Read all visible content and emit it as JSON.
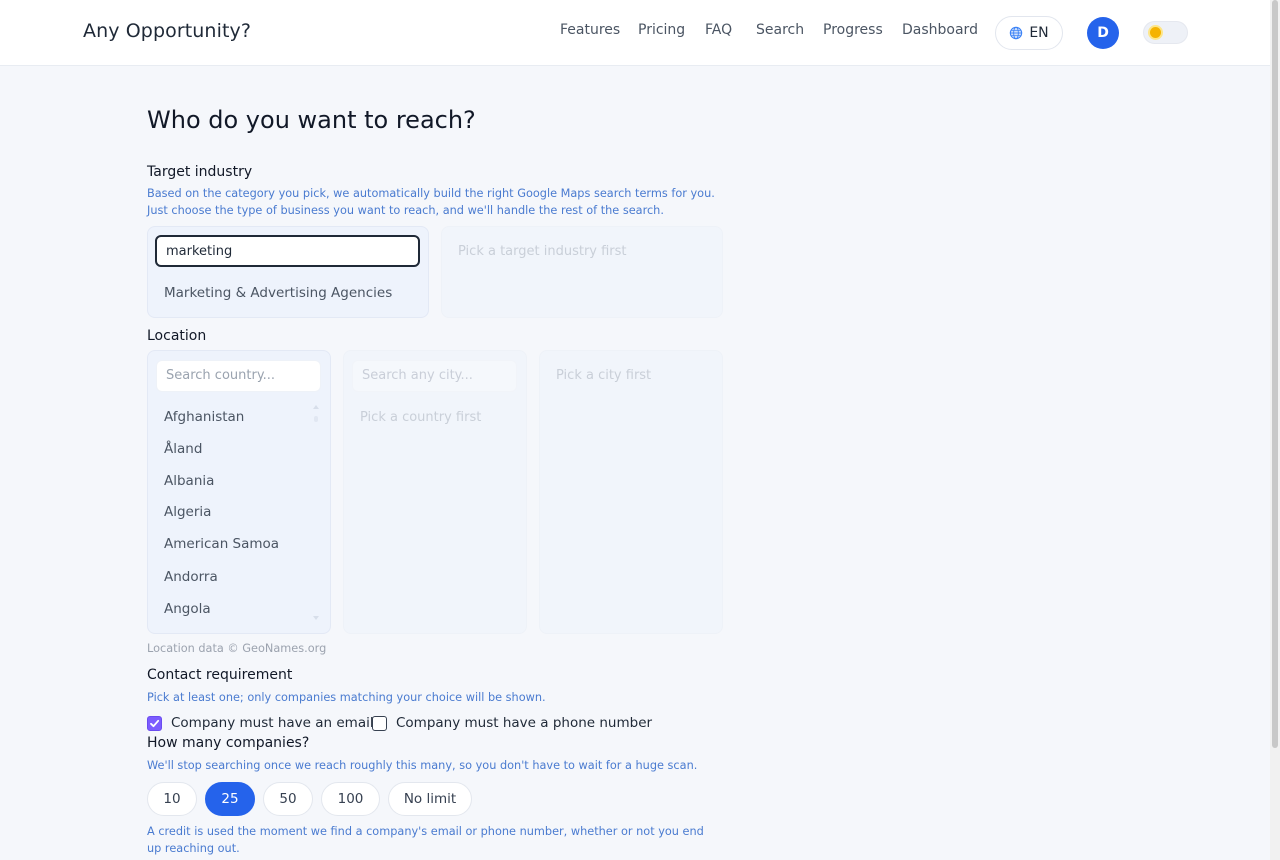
{
  "header": {
    "brand": "Any Opportunity?",
    "nav": [
      "Features",
      "Pricing",
      "FAQ",
      "Search",
      "Progress",
      "Dashboard"
    ],
    "language": "EN",
    "avatar_initial": "D",
    "icons": {
      "language": "globe-icon",
      "theme": "sun-toggle-icon"
    }
  },
  "main": {
    "title": "Who do you want to reach?",
    "industry": {
      "label": "Target industry",
      "help": "Based on the category you pick, we automatically build the right Google Maps search terms for you. Just choose the type of business you want to reach, and we'll handle the rest of the search.",
      "input_value": "marketing",
      "suggestion": "Marketing & Advertising Agencies",
      "secondary_placeholder": "Pick a target industry first"
    },
    "location": {
      "label": "Location",
      "country_placeholder": "Search country...",
      "countries": [
        "Afghanistan",
        "Åland",
        "Albania",
        "Algeria",
        "American Samoa",
        "Andorra",
        "Angola"
      ],
      "city_placeholder": "Search any city...",
      "city_empty": "Pick a country first",
      "area_empty": "Pick a city first",
      "credit": "Location data © GeoNames.org"
    },
    "contact": {
      "label": "Contact requirement",
      "help": "Pick at least one; only companies matching your choice will be shown.",
      "email_label": "Company must have an email",
      "email_checked": true,
      "phone_label": "Company must have a phone number",
      "phone_checked": false
    },
    "count": {
      "label": "How many companies?",
      "help": "We'll stop searching once we reach roughly this many, so you don't have to wait for a huge scan.",
      "options": [
        "10",
        "25",
        "50",
        "100",
        "No limit"
      ],
      "selected": "25",
      "note": "A credit is used the moment we find a company's email or phone number, whether or not you end up reaching out."
    }
  },
  "colors": {
    "accent": "#2563eb",
    "checkbox": "#7c5cff",
    "help_text": "#4a7bd0",
    "background": "#f5f7fb"
  }
}
